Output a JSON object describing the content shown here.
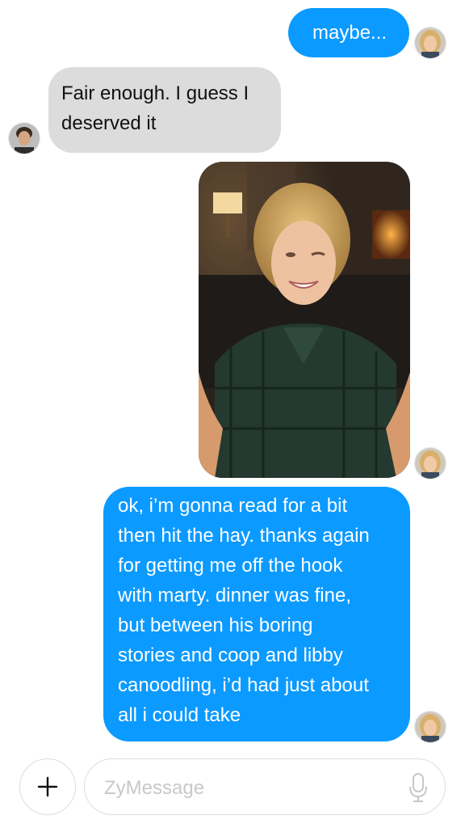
{
  "conversation": {
    "messages": [
      {
        "sender": "me",
        "text": "maybe..."
      },
      {
        "sender": "contact",
        "lines": [
          "Fair enough. I guess I",
          "deserved it"
        ]
      },
      {
        "sender": "me",
        "type": "photo"
      },
      {
        "sender": "me",
        "lines": [
          "ok, i’m gonna read for a bit",
          "then hit the hay. thanks again",
          "for getting me off the hook",
          "with marty. dinner was fine,",
          "but between his boring",
          "stories and coop and libby",
          "canoodling, i’d had just about",
          "all i could take"
        ]
      }
    ]
  },
  "composer": {
    "placeholder": "ZyMessage",
    "plus_icon": "plus-icon",
    "mic_icon": "microphone-icon"
  },
  "colors": {
    "sent_bubble": "#0b9aff",
    "received_bubble": "#dcdcdc"
  }
}
